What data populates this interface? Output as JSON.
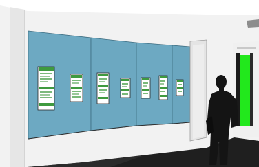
{
  "colors": {
    "wall": "#f4f4f4",
    "ceiling": "#ffffff",
    "floor": "#1e1e1e",
    "panel": "#6da9c2",
    "panel_edge": "#3e6e82",
    "screen_header": "#3f9a3f",
    "screen_body": "#ffffff",
    "doorway_light": "#22e81c",
    "person": "#141414"
  },
  "scene": {
    "display_panels": 4,
    "screens": 7,
    "signage_text": ""
  }
}
